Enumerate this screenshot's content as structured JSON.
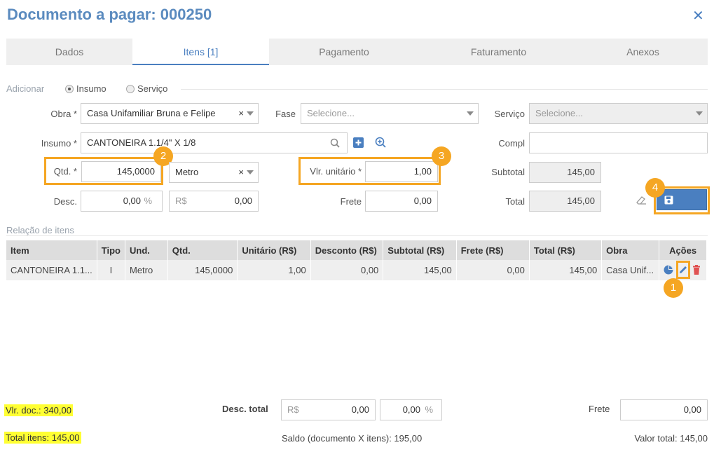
{
  "header": {
    "title": "Documento a pagar: 000250",
    "close": "✕"
  },
  "tabs": [
    {
      "label": "Dados"
    },
    {
      "label": "Itens [1]"
    },
    {
      "label": "Pagamento"
    },
    {
      "label": "Faturamento"
    },
    {
      "label": "Anexos"
    }
  ],
  "add": {
    "label": "Adicionar",
    "opt1": "Insumo",
    "opt2": "Serviço",
    "selected": "Insumo"
  },
  "form": {
    "obra_label": "Obra *",
    "obra_value": "Casa Unifamiliar Bruna e Felipe",
    "fase_label": "Fase",
    "fase_placeholder": "Selecione...",
    "servico_label": "Serviço",
    "servico_placeholder": "Selecione...",
    "insumo_label": "Insumo *",
    "insumo_value": "CANTONEIRA 1.1/4\" X 1/8",
    "compl_label": "Compl",
    "compl_value": "",
    "qtd_label": "Qtd. *",
    "qtd_value": "145,0000",
    "und_value": "Metro",
    "vlr_label": "Vlr. unitário *",
    "vlr_value": "1,00",
    "subtotal_label": "Subtotal",
    "subtotal_value": "145,00",
    "desc_label": "Desc.",
    "desc_pct": "0,00",
    "pct_sign": "%",
    "desc_rs_prefix": "R$",
    "desc_rs": "0,00",
    "frete_label": "Frete",
    "frete_value": "0,00",
    "total_label": "Total",
    "total_value": "145,00",
    "save_label": "Salvar"
  },
  "badges": [
    "1",
    "2",
    "3",
    "4"
  ],
  "items": {
    "label": "Relação de itens",
    "columns": [
      "Item",
      "Tipo",
      "Und.",
      "Qtd.",
      "Unitário (R$)",
      "Desconto (R$)",
      "Subtotal (R$)",
      "Frete (R$)",
      "Total (R$)",
      "Obra",
      "Ações"
    ],
    "rows": [
      [
        "CANTONEIRA 1.1...",
        "I",
        "Metro",
        "145,0000",
        "1,00",
        "0,00",
        "145,00",
        "0,00",
        "145,00",
        "Casa Unif..."
      ]
    ]
  },
  "footer": {
    "vlr_doc": "Vlr. doc.: 340,00",
    "total_itens": "Total itens: 145,00",
    "desc_total_label": "Desc. total",
    "desc_rs_prefix": "R$",
    "desc_rs": "0,00",
    "desc_pct": "0,00",
    "pct_sign": "%",
    "frete_label": "Frete",
    "frete_value": "0,00",
    "saldo": "Saldo (documento X itens): 195,00",
    "valor_total": "Valor total: 145,00"
  },
  "colors": {
    "accent": "#4a7fc0",
    "highlight": "#f5a623",
    "marker": "#ffff33",
    "delete": "#e05252"
  },
  "icons": [
    "close-icon",
    "search-icon",
    "add-square-icon",
    "add-circle-icon",
    "eraser-icon",
    "save-icon",
    "pie-chart-icon",
    "pencil-icon",
    "trash-icon"
  ]
}
